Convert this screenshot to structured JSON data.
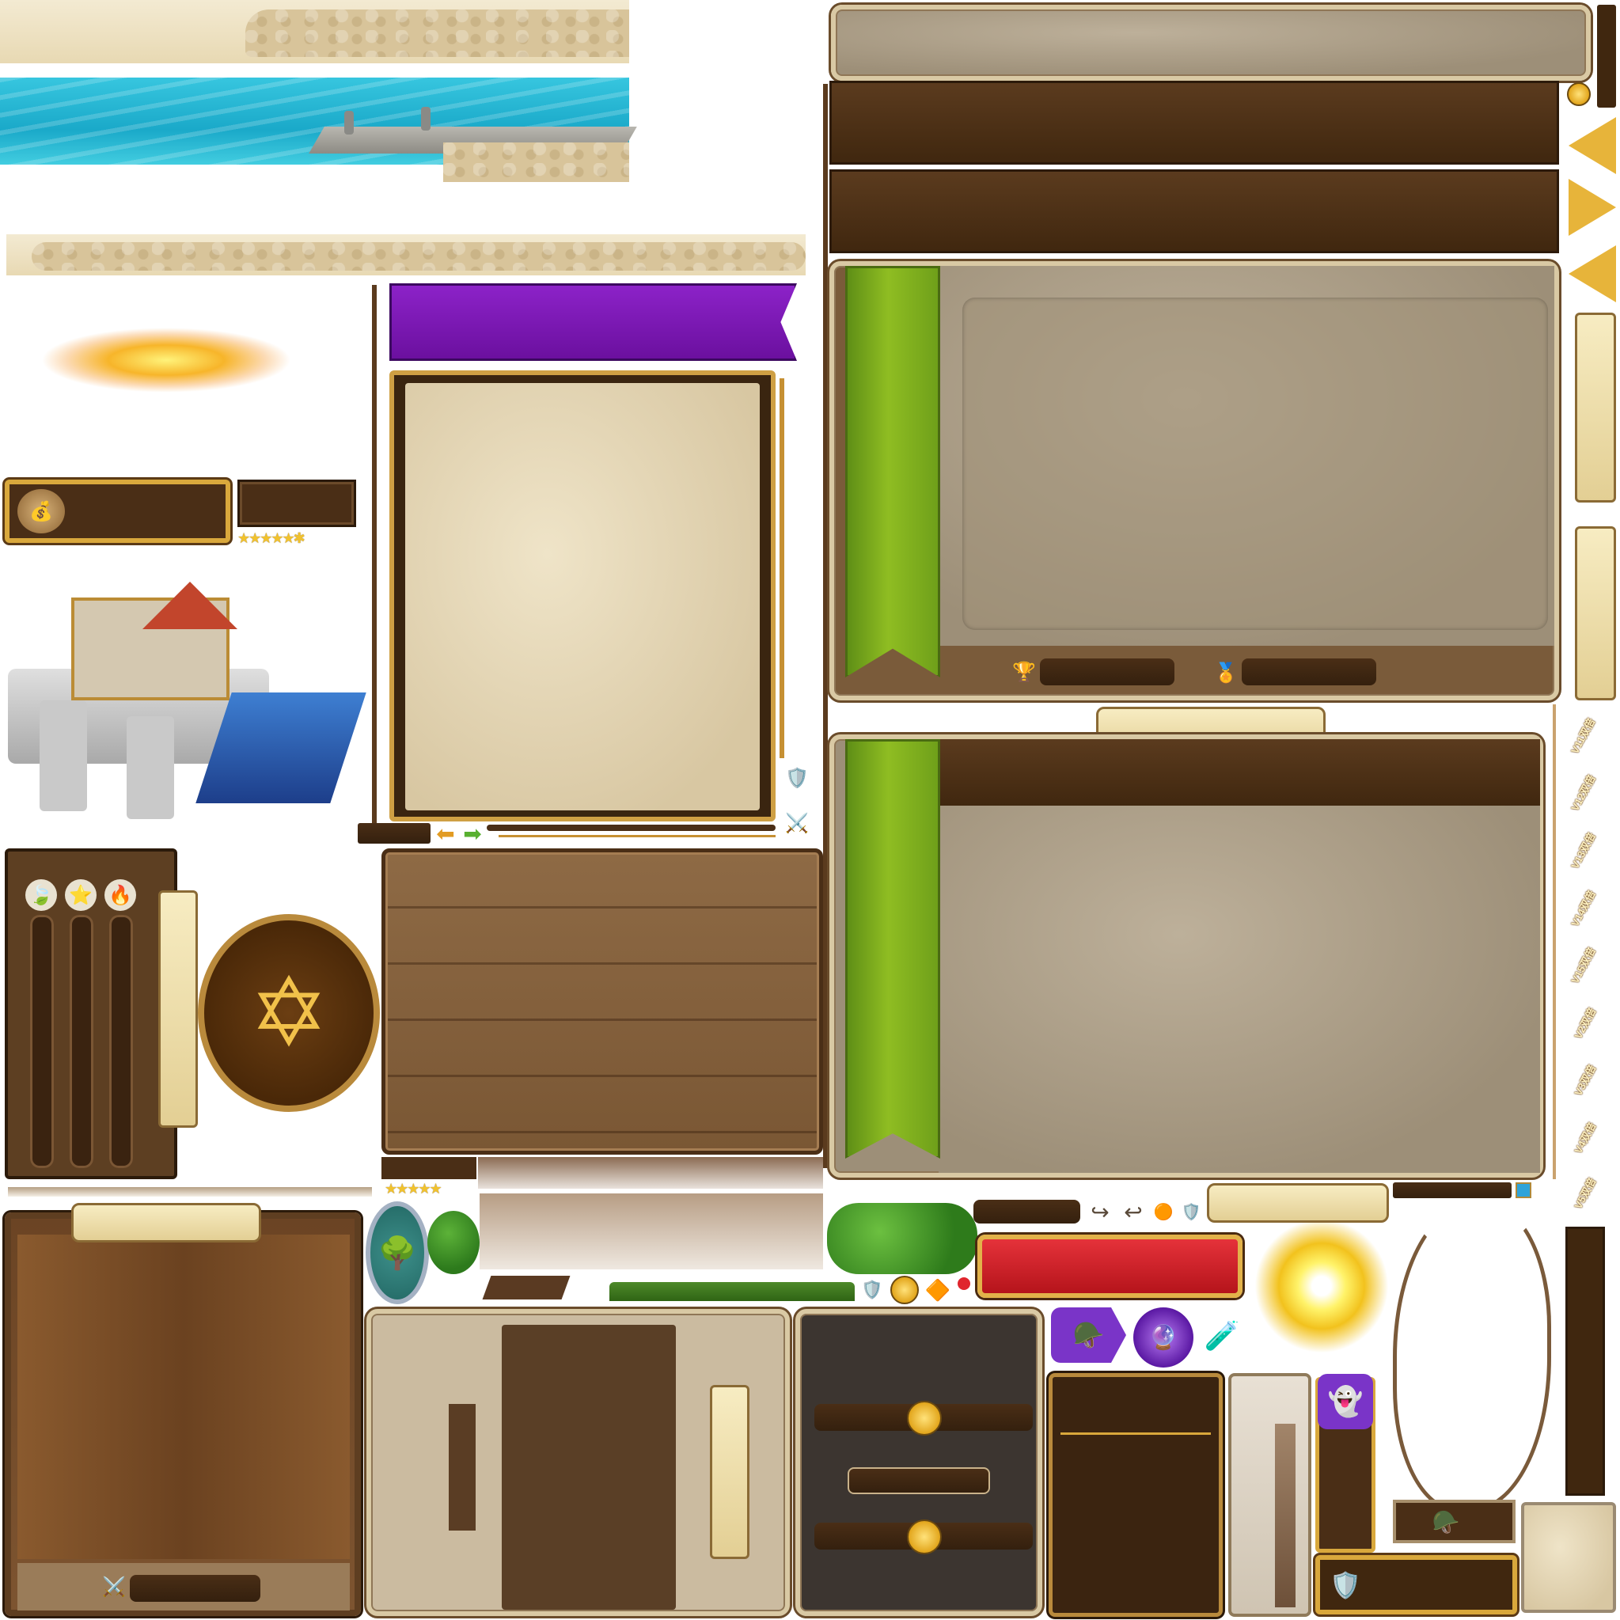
{
  "sheet": {
    "title": ""
  },
  "terrain": {
    "road_top": "stone-road-strip",
    "water": "water-dock-strip",
    "road_bottom": "stone-road-strip-thin"
  },
  "icons": {
    "sunburst_orange": "sunburst-icon",
    "sunburst_yellow": "sunburst-icon",
    "money_bag": "money-bag-icon",
    "castle": "castle-icon",
    "trophy": "trophy-icon",
    "medal": "medal-icon",
    "sword_shield": "sword-shield-icon",
    "crossed_swords": "crossed-swords-icon",
    "magic_circle": "magic-circle-icon",
    "tree_badge": "tree-badge-icon",
    "bush": "bush-icon",
    "coin": "coin-icon",
    "gem": "gem-icon",
    "shield": "shield-icon",
    "ghost": "ghost-icon",
    "helmet": "helmet-icon",
    "orb": "orb-icon",
    "potion": "potion-icon",
    "arrow_left": "arrow-left-icon",
    "arrow_right": "arrow-right-icon",
    "redo": "redo-icon",
    "undo": "undo-icon"
  },
  "stars": {
    "row1": "★★★★★✱",
    "row2": "★★★★★"
  },
  "vip_ribbons": [
    "V11双倍",
    "V12双倍",
    "V13双倍",
    "V14双倍",
    "V15双倍",
    "V2双倍",
    "V3双倍",
    "V4双倍",
    "V5双倍"
  ],
  "colors": {
    "brown_dark": "#40270f",
    "parchment": "#9d8f78",
    "green_banner": "#8fbd22",
    "purple_banner": "#7a16b8",
    "red_ribbon": "#d21f24",
    "gold": "#e7b43a",
    "water": "#1aa9c9"
  }
}
